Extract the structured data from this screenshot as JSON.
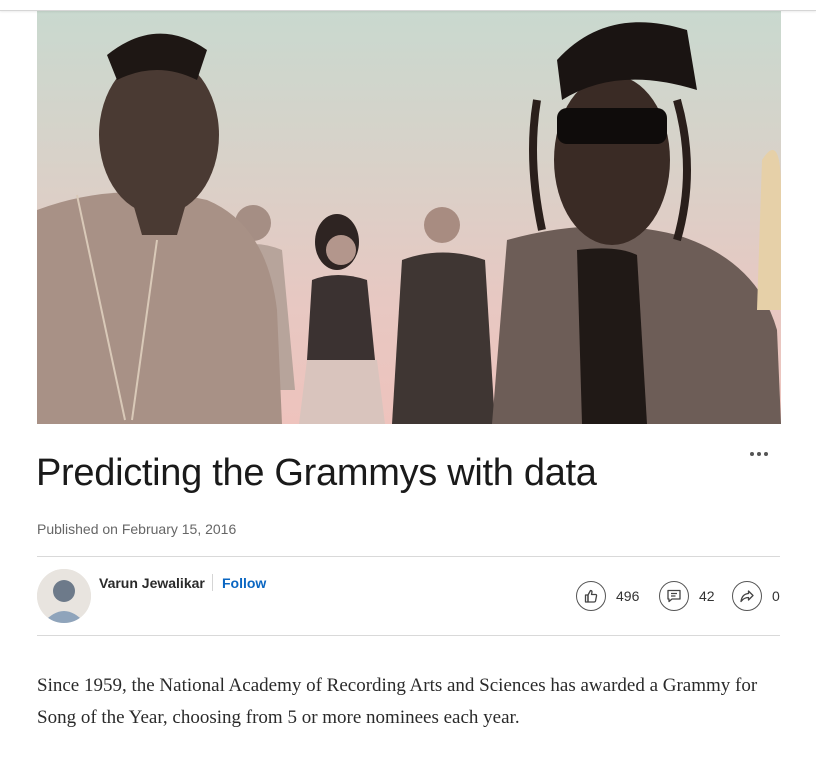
{
  "article": {
    "title": "Predicting the Grammys with data",
    "published": "Published on February 15, 2016",
    "body": "Since 1959, the National Academy of Recording Arts and Sciences has awarded a Grammy for Song of the Year, choosing from 5 or more nominees each year."
  },
  "author": {
    "name": "Varun Jewalikar",
    "follow_label": "Follow"
  },
  "social": {
    "likes": "496",
    "comments": "42",
    "shares": "0"
  },
  "icons": {
    "like": "thumbs-up-icon",
    "comment": "comment-icon",
    "share": "share-icon",
    "more": "more-options-icon"
  },
  "colors": {
    "accent": "#0a66c2",
    "text": "#1a1a1a",
    "muted": "#666666"
  }
}
